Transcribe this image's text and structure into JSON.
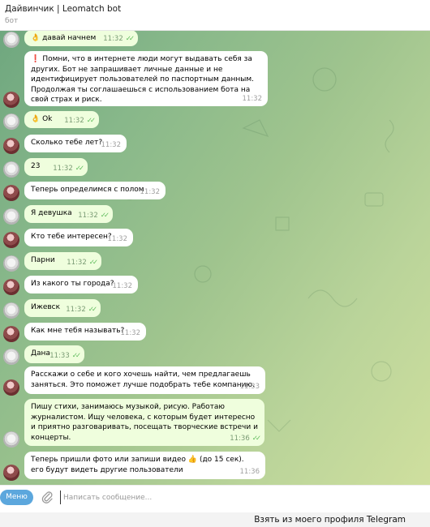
{
  "header": {
    "title": "Дайвинчик | Leomatch bot",
    "subtitle": "бот"
  },
  "messages": [
    {
      "dir": "out",
      "text": "давай начнем",
      "emoji": "👌",
      "time": "11:32",
      "checks": true
    },
    {
      "dir": "in",
      "bang": "❗",
      "text": "Помни, что в интернете люди могут выдавать себя за других. Бот не запрашивает личные данные и не идентифицирует пользователей по паспортным данным. Продолжая ты соглашаешься с использованием бота на свой страх и риск.",
      "time": "11:32"
    },
    {
      "dir": "out",
      "text": "Ok",
      "emoji": "👌",
      "time": "11:32",
      "checks": true
    },
    {
      "dir": "in",
      "text": "Сколько тебе лет?",
      "time": "11:32"
    },
    {
      "dir": "out",
      "text": "23",
      "time": "11:32",
      "checks": true
    },
    {
      "dir": "in",
      "text": "Теперь определимся с полом",
      "time": "11:32"
    },
    {
      "dir": "out",
      "text": "Я девушка",
      "time": "11:32",
      "checks": true
    },
    {
      "dir": "in",
      "text": "Кто тебе интересен?",
      "time": "11:32"
    },
    {
      "dir": "out",
      "text": "Парни",
      "time": "11:32",
      "checks": true
    },
    {
      "dir": "in",
      "text": "Из какого ты города?",
      "time": "11:32"
    },
    {
      "dir": "out",
      "text": "Ижевск",
      "time": "11:32",
      "checks": true
    },
    {
      "dir": "in",
      "text": "Как мне тебя называть?",
      "time": "11:32"
    },
    {
      "dir": "out",
      "text": "Дана",
      "time": "11:33",
      "checks": true
    },
    {
      "dir": "in",
      "text": "Расскажи о себе и кого хочешь найти, чем предлагаешь заняться. Это поможет лучше подобрать тебе компанию.",
      "time": "11:33"
    },
    {
      "dir": "out",
      "text": "Пишу стихи, занимаюсь музыкой, рисую. Работаю журналистом. Ищу человека, с которым будет интересно и приятно разговаривать, посещать творческие встречи и концерты.",
      "time": "11:36",
      "checks": true
    },
    {
      "dir": "in",
      "text": "Теперь пришли фото или запиши видео",
      "emoji": "👍",
      "text2": "(до 15 сек). его будут видеть другие пользователи",
      "time": "11:36"
    }
  ],
  "composer": {
    "menu_label": "Меню",
    "placeholder": "Написать сообщение..."
  },
  "keyboard": {
    "button_label": "Взять из моего профиля Telegram"
  },
  "colors": {
    "out_bubble": "#effedd",
    "in_bubble": "#ffffff",
    "accent": "#5ca7dd",
    "check": "#5dbb5a"
  }
}
